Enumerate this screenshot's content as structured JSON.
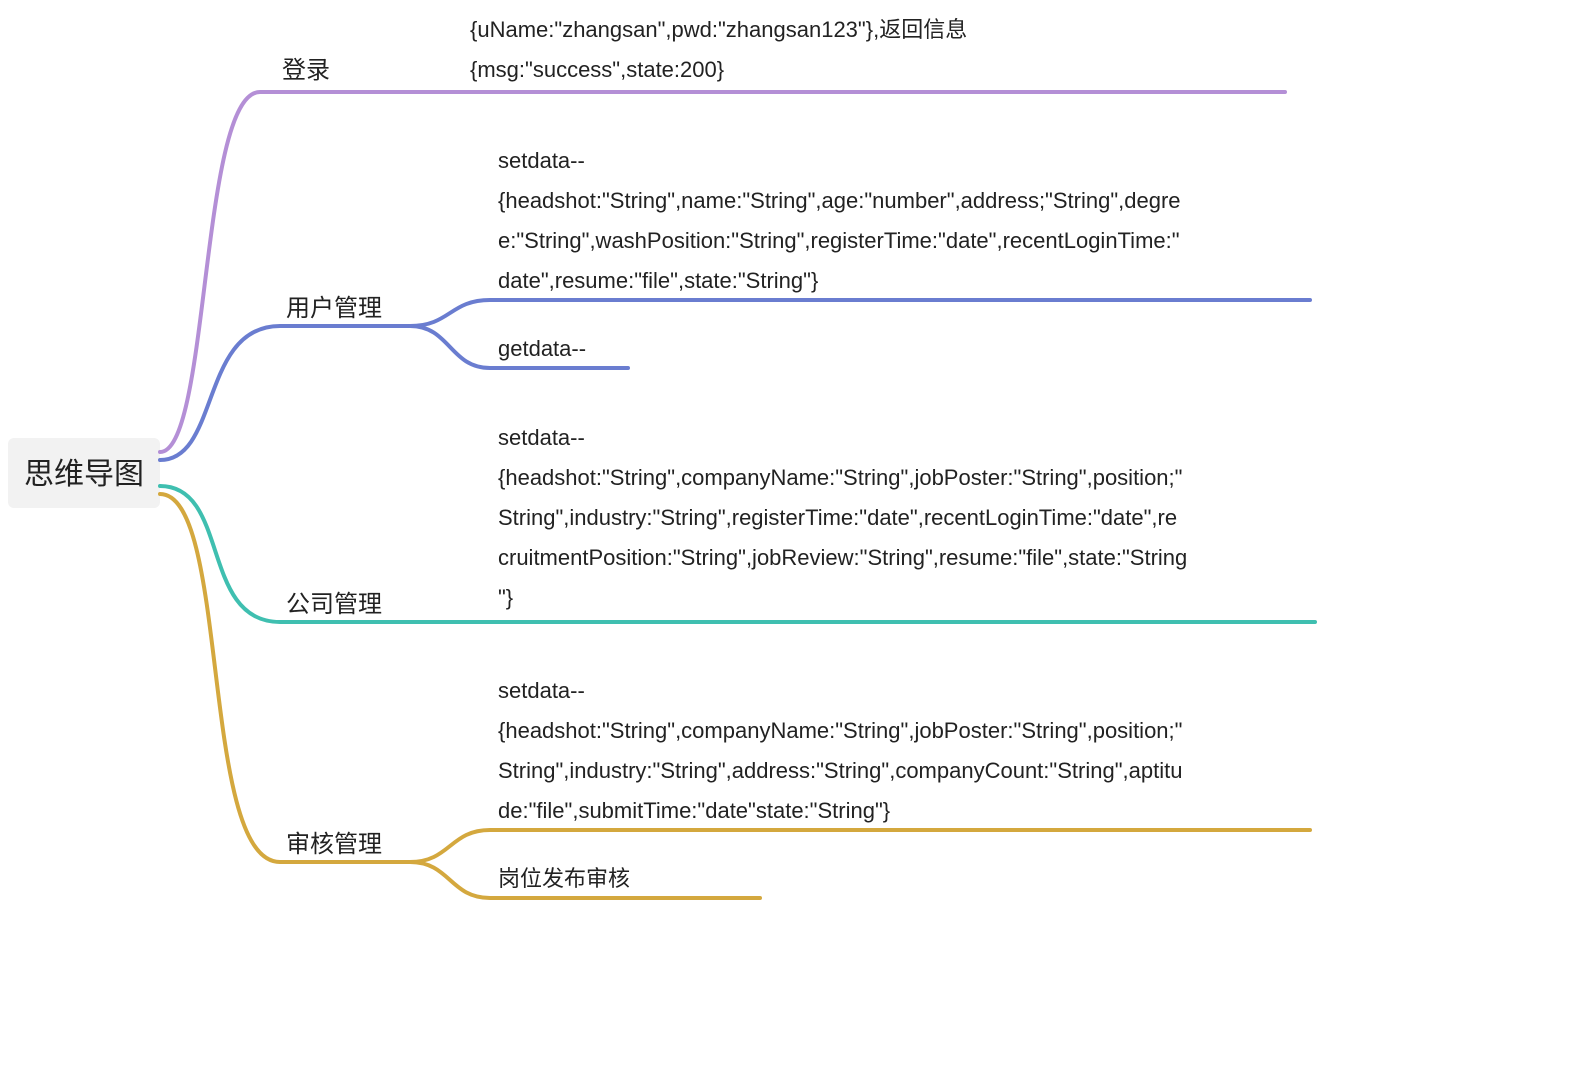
{
  "root": {
    "label": "思维导图"
  },
  "branches": {
    "login": {
      "label": "登录",
      "leaves": [
        {
          "lines": [
            "{uName:\"zhangsan\",pwd:\"zhangsan123\"},返回信息",
            "{msg:\"success\",state:200}"
          ]
        }
      ]
    },
    "user": {
      "label": "用户管理",
      "leaves": [
        {
          "lines": [
            "setdata--",
            "{headshot:\"String\",name:\"String\",age:\"number\",address;\"String\",degre",
            "e:\"String\",washPosition:\"String\",registerTime:\"date\",recentLoginTime:\"",
            "date\",resume:\"file\",state:\"String\"}"
          ]
        },
        {
          "lines": [
            "getdata--"
          ]
        }
      ]
    },
    "company": {
      "label": "公司管理",
      "leaves": [
        {
          "lines": [
            "setdata--",
            "{headshot:\"String\",companyName:\"String\",jobPoster:\"String\",position;\"",
            "String\",industry:\"String\",registerTime:\"date\",recentLoginTime:\"date\",re",
            "cruitmentPosition:\"String\",jobReview:\"String\",resume:\"file\",state:\"String",
            "\"}"
          ]
        }
      ]
    },
    "audit": {
      "label": "审核管理",
      "leaves": [
        {
          "lines": [
            "setdata--",
            "{headshot:\"String\",companyName:\"String\",jobPoster:\"String\",position;\"",
            "String\",industry:\"String\",address:\"String\",companyCount:\"String\",aptitu",
            "de:\"file\",submitTime:\"date\"state:\"String\"}"
          ]
        },
        {
          "lines": [
            "岗位发布审核"
          ]
        }
      ]
    }
  },
  "colors": {
    "purple": "#b48fd6",
    "blue": "#6a7dd0",
    "teal": "#3fbfb0",
    "gold": "#d4a83e"
  }
}
